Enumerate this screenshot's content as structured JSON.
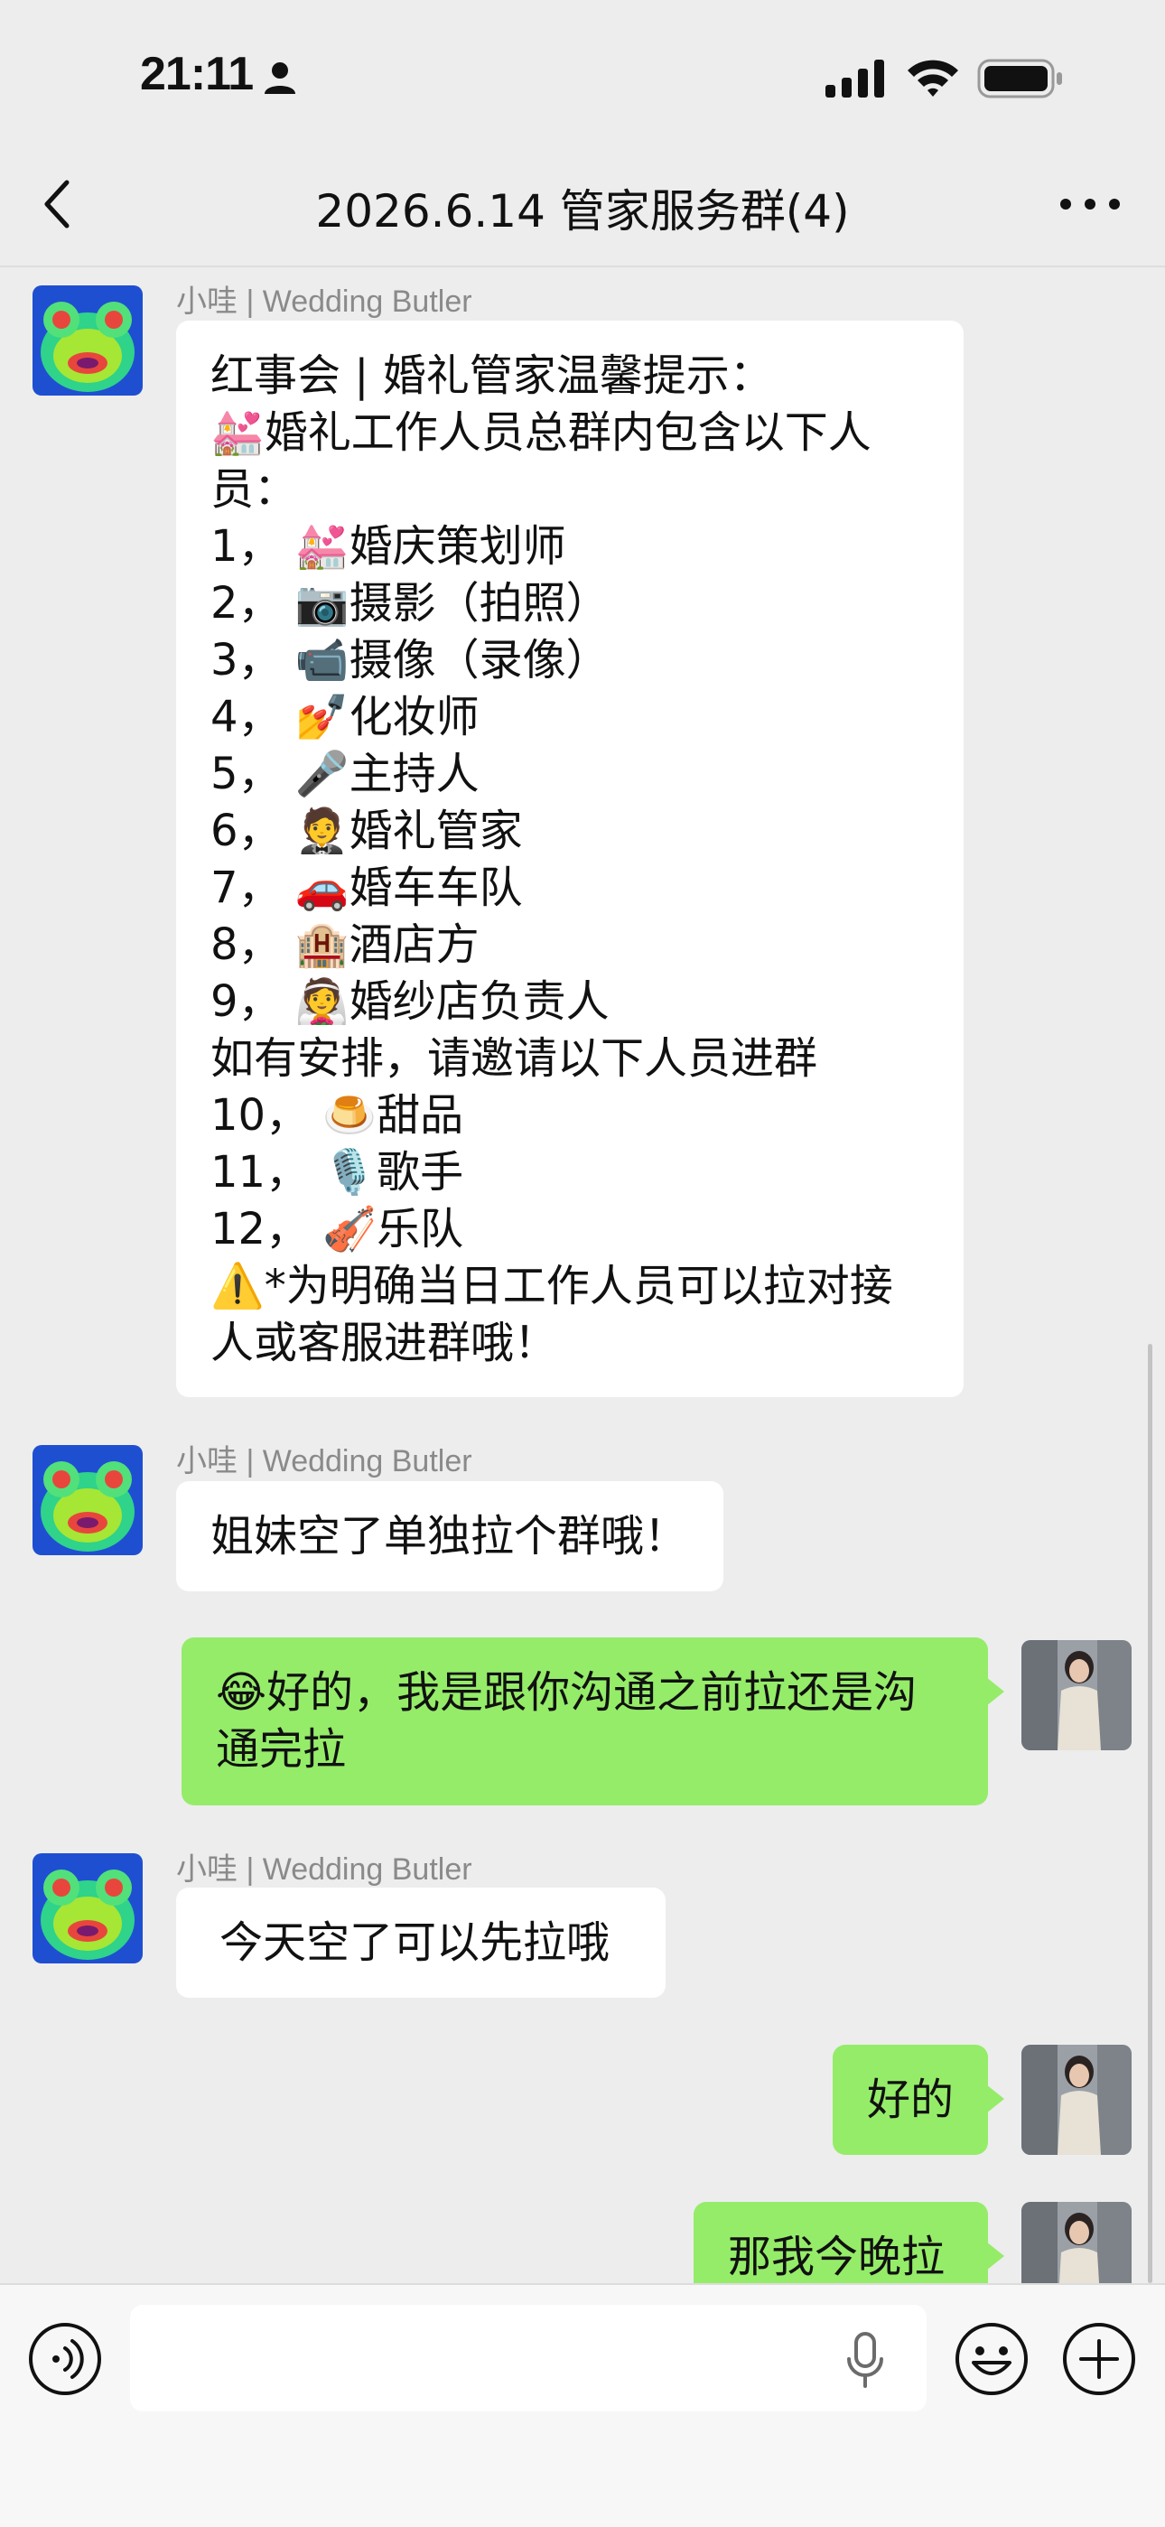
{
  "status_bar": {
    "time": "21:11",
    "icons": [
      "person-icon",
      "cellular-signal-icon",
      "wifi-icon",
      "battery-icon"
    ]
  },
  "header": {
    "title": "2026.6.14 管家服务群(4)",
    "back_icon": "chevron-left-icon",
    "more_icon": "ellipsis-icon"
  },
  "messages": [
    {
      "direction": "incoming",
      "sender": "小哇 | Wedding Butler",
      "text": "红事会 | 婚礼管家温馨提示：\n💒婚礼工作人员总群内包含以下人\n员：\n1， 💒婚庆策划师\n2， 📷摄影（拍照）\n3， 📹摄像（录像）\n4， 💅化妆师\n5， 🎤主持人\n6， 🤵婚礼管家\n7， 🚗婚车车队\n8， 🏨酒店方\n9， 👰婚纱店负责人\n如有安排，请邀请以下人员进群\n10， 🍮甜品\n11， 🎙️歌手\n12， 🎻乐队\n⚠️*为明确当日工作人员可以拉对接\n人或客服进群哦！"
    },
    {
      "direction": "incoming",
      "sender": "小哇 | Wedding Butler",
      "text": "姐妹空了单独拉个群哦！"
    },
    {
      "direction": "outgoing",
      "text": "😂好的，我是跟你沟通之前拉还是沟\n通完拉"
    },
    {
      "direction": "incoming",
      "sender": "小哇 | Wedding Butler",
      "text": "今天空了可以先拉哦"
    },
    {
      "direction": "outgoing",
      "text": "好的"
    },
    {
      "direction": "outgoing",
      "text": "那我今晚拉"
    }
  ],
  "input_bar": {
    "placeholder": "",
    "voice_icon": "voice-mode-icon",
    "mic_icon": "microphone-icon",
    "emoji_icon": "emoji-icon",
    "plus_icon": "plus-icon"
  },
  "colors": {
    "background": "#ededed",
    "incoming_bubble": "#ffffff",
    "outgoing_bubble": "#95ec69",
    "sender_name": "#8a8a8a"
  }
}
